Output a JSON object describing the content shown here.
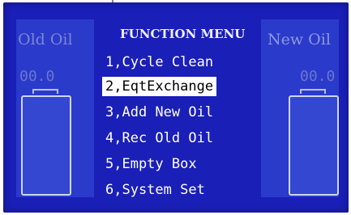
{
  "left_tank": {
    "title": "Old Oil",
    "value": "00.0",
    "fill_fraction": 0.0
  },
  "right_tank": {
    "title": "New Oil",
    "value": "00.0",
    "fill_fraction": 0.0
  },
  "menu": {
    "title": "FUNCTION MENU",
    "selected_index": 1,
    "items": [
      {
        "label": "1,Cycle Clean"
      },
      {
        "label": "2,EqtExchange"
      },
      {
        "label": "3,Add New Oil"
      },
      {
        "label": "4,Rec Old Oil"
      },
      {
        "label": "5,Empty Box"
      },
      {
        "label": "6,System Set"
      }
    ]
  },
  "colors": {
    "screen_bg": "#1a1fb8",
    "panel_bg": "#2a3acb",
    "highlight_bg": "#ffffff",
    "text": "#ffffff"
  }
}
